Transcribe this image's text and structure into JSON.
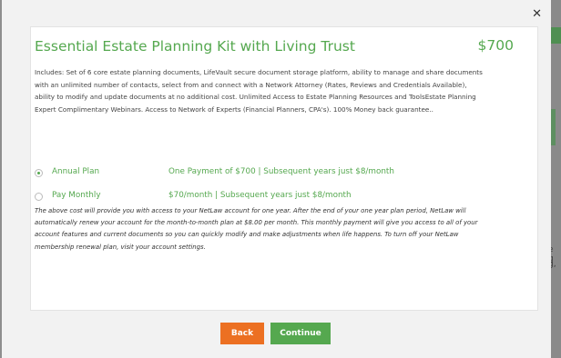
{
  "background": {
    "right_text_1": "e g",
    "right_text_2": "g,"
  },
  "modal": {
    "close_icon": "close-icon"
  },
  "kit": {
    "title": "Essential Estate Planning Kit with Living Trust",
    "price": "$700",
    "includes": "Includes: Set of 6 core estate planning documents, LifeVault secure document storage platform, ability to manage and share documents with an unlimited number of contacts, select from and connect with a Network Attorney (Rates, Reviews and Credentials Available), ability to modify and update documents at no additional cost. Unlimited Access to Estate Planning Resources and ToolsEstate Planning Expert Complimentary Webinars. Access to Network of Experts (Financial Planners, CPA's). 100% Money back guarantee.."
  },
  "plans": [
    {
      "name": "Annual Plan",
      "description": "One Payment of $700 | Subsequent years just $8/month",
      "selected": true
    },
    {
      "name": "Pay Monthly",
      "description": "$70/month | Subsequent years just $8/month",
      "selected": false
    }
  ],
  "note": "The above cost will provide you with access to your NetLaw account for one year. After the end of your one year plan period, NetLaw will automatically renew your account for the month-to-month plan at $8.00 per month. This monthly payment will give you access to all of your account features and current documents so you can quickly modify and make adjustments when life happens. To turn off your NetLaw membership renewal plan, visit your account settings.",
  "buttons": {
    "back": "Back",
    "continue": "Continue"
  },
  "colors": {
    "accent_green": "#55a84f",
    "back_orange": "#ec7022"
  }
}
